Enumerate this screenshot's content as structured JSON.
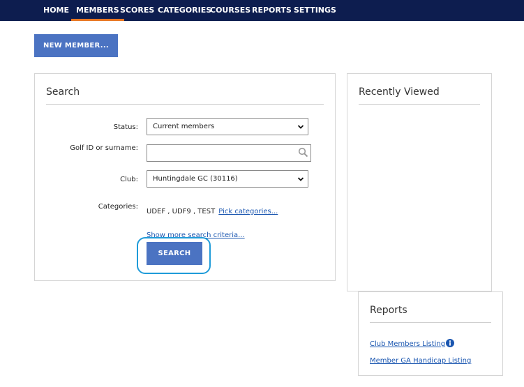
{
  "nav": {
    "items": [
      "HOME",
      "MEMBERS",
      "SCORES",
      "CATEGORIES",
      "COURSES",
      "REPORTS",
      "SETTINGS"
    ],
    "active": "MEMBERS"
  },
  "new_member_label": "NEW MEMBER...",
  "search": {
    "title": "Search",
    "status_label": "Status:",
    "status_value": "Current members",
    "golf_id_label": "Golf ID or surname:",
    "golf_id_value": "",
    "club_label": "Club:",
    "club_value": "Huntingdale GC (30116)",
    "categories_label": "Categories:",
    "categories_value": "UDEF , UDF9 , TEST",
    "pick_categories_link": "Pick categories...",
    "show_more_link": "Show more search criteria...",
    "search_button": "SEARCH"
  },
  "recently_viewed": {
    "title": "Recently Viewed"
  },
  "reports": {
    "title": "Reports",
    "links": [
      "Club Members Listing",
      "Member GA Handicap Listing"
    ]
  },
  "colors": {
    "nav_bg": "#0d1d4f",
    "nav_active_underline": "#e87722",
    "button_bg": "#4b73c2",
    "link": "#1a56b0",
    "focus_ring": "#1e9bd9"
  },
  "icons": [
    "magnifier-icon",
    "chevron-down-icon",
    "info-icon"
  ]
}
